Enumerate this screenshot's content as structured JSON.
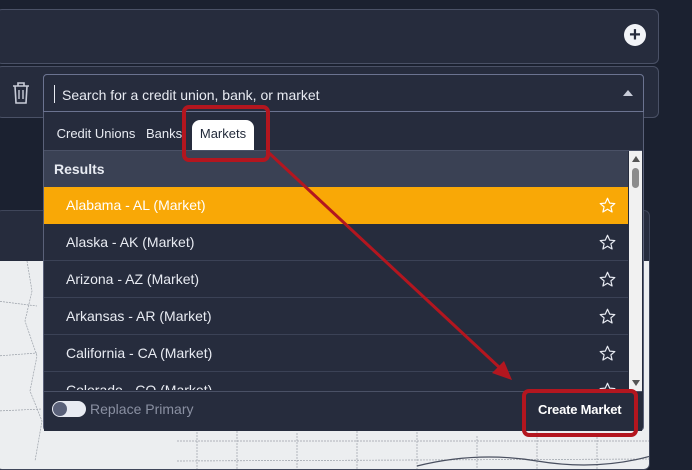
{
  "search": {
    "placeholder": "Search for a credit union, bank, or market"
  },
  "tabs": [
    {
      "label": "Credit Unions",
      "active": false
    },
    {
      "label": "Banks",
      "active": false
    },
    {
      "label": "Markets",
      "active": true
    }
  ],
  "results": {
    "heading": "Results",
    "items": [
      {
        "label": "Alabama - AL (Market)",
        "selected": true
      },
      {
        "label": "Alaska - AK (Market)",
        "selected": false
      },
      {
        "label": "Arizona - AZ (Market)",
        "selected": false
      },
      {
        "label": "Arkansas - AR (Market)",
        "selected": false
      },
      {
        "label": "California - CA (Market)",
        "selected": false
      },
      {
        "label": "Colorado - CO (Market)",
        "selected": false
      }
    ]
  },
  "footer": {
    "toggle_label": "Replace Primary",
    "toggle_on": false,
    "create_label": "Create Market"
  },
  "icons": {
    "add": "plus-circle-icon",
    "trash": "trash-icon",
    "star": "star-outline-icon",
    "dropdown": "caret-up-icon"
  },
  "colors": {
    "accent": "#f9a806",
    "annotation": "#b3161f",
    "background": "#1b2130",
    "panel": "#262c3d"
  }
}
